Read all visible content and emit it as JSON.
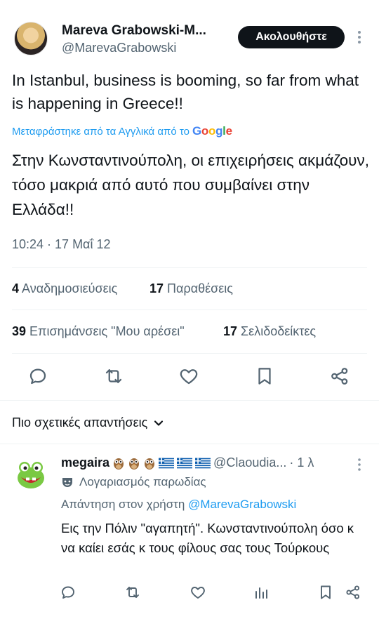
{
  "tweet": {
    "author_name": "Mareva Grabowski-M...",
    "author_handle": "@MarevaGrabowski",
    "follow_label": "Ακολουθήστε",
    "text": "In Istanbul, business is booming, so far from what is happening in Greece!!",
    "translated_label": "Μεταφράστηκε από τα Αγγλικά από το",
    "translator": "Google",
    "translated_text": "Στην Κωνσταντινούπολη, οι επιχειρήσεις ακμάζουν, τόσο μακριά από αυτό που συμβαίνει στην Ελλάδα!!",
    "timestamp": "10:24 · 17 Μαΐ 12",
    "stats": {
      "reposts_count": "4",
      "reposts_label": "Αναδημοσιεύσεις",
      "quotes_count": "17",
      "quotes_label": "Παραθέσεις",
      "likes_count": "39",
      "likes_label": "Επισημάνσεις \"Μου αρέσει\"",
      "bookmarks_count": "17",
      "bookmarks_label": "Σελιδοδείκτες"
    },
    "actions": [
      "reply-icon",
      "repost-icon",
      "like-icon",
      "bookmark-icon",
      "share-icon"
    ]
  },
  "replies_header": "Πιο σχετικές απαντήσεις",
  "reply": {
    "name": "megaira",
    "handle": "@Claoudia...",
    "time": "· 1 λ",
    "parody_label": "Λογαριασμός παρωδίας",
    "reply_to_prefix": "Απάντηση στον χρήστη",
    "reply_to_handle": "@MarevaGrabowski",
    "text": "Εις την Πόλιν \"αγαπητή\". Κωνσταντινούπολη όσο κ να καίει εσάς κ τους φίλους σας τους Τούρκους",
    "actions": [
      "reply-icon",
      "repost-icon",
      "like-icon",
      "views-icon",
      "bookmark-icon",
      "share-icon"
    ]
  },
  "colors": {
    "text": "#0f1419",
    "muted": "#536471",
    "link": "#1d9bf0",
    "divider": "#eff3f4",
    "button_bg": "#0f1419"
  }
}
